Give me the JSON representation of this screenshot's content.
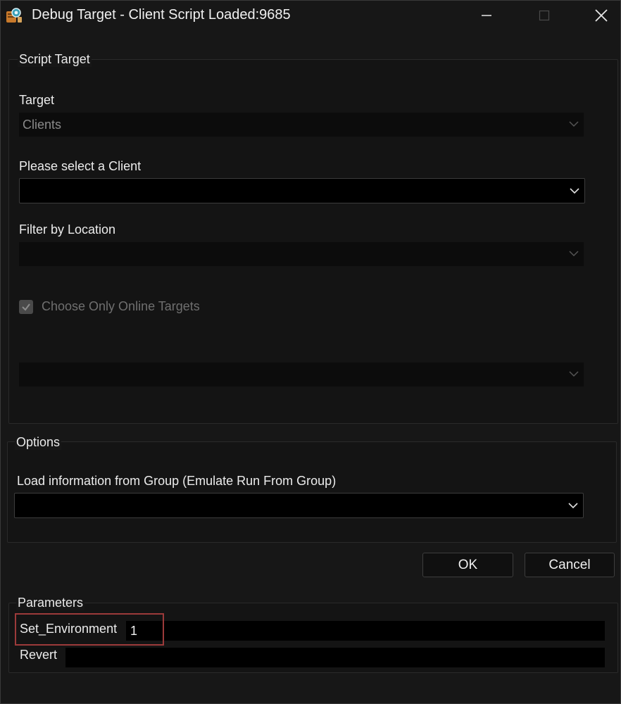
{
  "window": {
    "title": "Debug Target - Client Script Loaded:9685",
    "icon": "script-debug-icon"
  },
  "script_target": {
    "group_label": "Script Target",
    "target": {
      "label": "Target",
      "value": "Clients",
      "enabled": false
    },
    "client": {
      "label": "Please select a Client",
      "value": "",
      "enabled": true
    },
    "location": {
      "label": "Filter by Location",
      "value": "",
      "enabled": false
    },
    "online_only": {
      "label": "Choose Only Online Targets",
      "checked": true,
      "enabled": false
    },
    "extra_combo": {
      "value": "",
      "enabled": false
    }
  },
  "options": {
    "group_label": "Options",
    "group_select": {
      "label": "Load information from Group (Emulate Run From Group)",
      "value": ""
    }
  },
  "buttons": {
    "ok": "OK",
    "cancel": "Cancel"
  },
  "parameters": {
    "group_label": "Parameters",
    "rows": [
      {
        "name": "Set_Environment",
        "value": "1"
      },
      {
        "name": "Revert",
        "value": ""
      }
    ]
  },
  "colors": {
    "background": "#171717",
    "highlight_border": "#9c3a3a",
    "disabled_text": "#6f6f6f"
  }
}
